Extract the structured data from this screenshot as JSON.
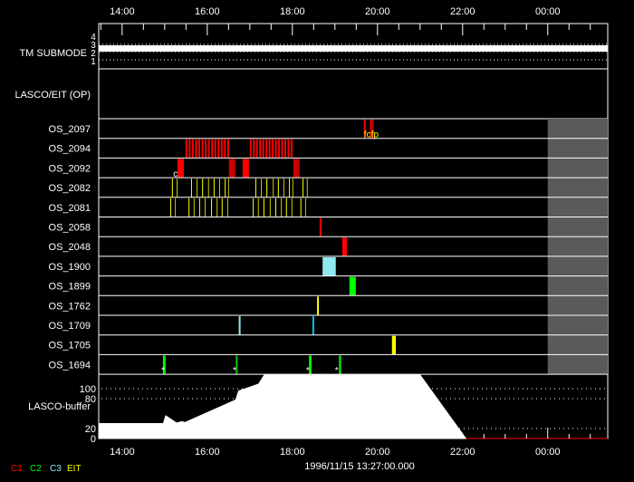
{
  "time_axis": {
    "start_hour": 13.45,
    "end_hour": 25.41,
    "tick_labels": [
      {
        "hour": 14,
        "label": "14:00"
      },
      {
        "hour": 16,
        "label": "16:00"
      },
      {
        "hour": 18,
        "label": "18:00"
      },
      {
        "hour": 20,
        "label": "20:00"
      },
      {
        "hour": 22,
        "label": "22:00"
      },
      {
        "hour": 24,
        "label": "00:00"
      }
    ]
  },
  "tm_submode": {
    "label": "TM SUBMODE",
    "levels": [
      "4",
      "3",
      "2",
      "1"
    ],
    "value": 3
  },
  "lasco_eit_label": "LASCO/EIT (OP)",
  "unavailable_from_hour": 24.0,
  "colors": {
    "c1": "#ff0000",
    "c1_dark": "#c80000",
    "c2": "#00ff00",
    "c2_dark": "#00c800",
    "c3": "#90e8f0",
    "c3_dark": "#00c8e0",
    "eit": "#ffff00",
    "eit_dark": "#c8c800",
    "gray": "#5a5a5a"
  },
  "rows": [
    {
      "name": "OS_2097",
      "events": [
        {
          "s": 19.68,
          "e": 19.72,
          "c": "c1"
        },
        {
          "s": 19.82,
          "e": 19.91,
          "c": "c1_dark"
        }
      ],
      "marks": [
        {
          "h": 19.68,
          "t": "fc"
        },
        {
          "h": 19.85,
          "t": "fp"
        }
      ]
    },
    {
      "name": "OS_2094",
      "groups": [
        {
          "s": 15.49,
          "e": 16.47,
          "n": 14,
          "c": "c1"
        },
        {
          "s": 17.0,
          "e": 17.96,
          "n": 14,
          "c": "c1"
        }
      ]
    },
    {
      "name": "OS_2092",
      "events": [
        {
          "s": 15.3,
          "e": 15.45,
          "c": "c1"
        },
        {
          "s": 16.51,
          "e": 16.66,
          "c": "c1_dark"
        },
        {
          "s": 16.83,
          "e": 16.98,
          "c": "c1"
        },
        {
          "s": 18.02,
          "e": 18.17,
          "c": "c1_dark"
        }
      ],
      "marks": [
        {
          "h": 15.2,
          "t": "c",
          "white": true
        }
      ]
    },
    {
      "name": "OS_2082",
      "lines": [
        15.17,
        15.28,
        15.62,
        15.75,
        15.88,
        16.02,
        16.15,
        16.28,
        16.41,
        16.49,
        17.13,
        17.26,
        17.39,
        17.54,
        17.66,
        17.79,
        17.92,
        18.0,
        18.24,
        18.34
      ],
      "c": "eit"
    },
    {
      "name": "OS_2081",
      "lines": [
        15.13,
        15.24,
        15.56,
        15.68,
        15.81,
        15.94,
        16.09,
        16.22,
        16.34,
        16.47,
        17.07,
        17.19,
        17.32,
        17.47,
        17.6,
        17.73,
        17.85,
        17.98,
        18.19,
        18.3
      ],
      "c": "eit"
    },
    {
      "name": "OS_2058",
      "events": [
        {
          "s": 18.64,
          "e": 18.68,
          "c": "c1"
        }
      ]
    },
    {
      "name": "OS_2048",
      "events": [
        {
          "s": 19.17,
          "e": 19.28,
          "c": "c1"
        }
      ]
    },
    {
      "name": "OS_1900",
      "events": [
        {
          "s": 18.71,
          "e": 19.02,
          "c": "c3"
        }
      ]
    },
    {
      "name": "OS_1899",
      "events": [
        {
          "s": 19.34,
          "e": 19.49,
          "c": "c2"
        }
      ]
    },
    {
      "name": "OS_1762",
      "events": [
        {
          "s": 18.58,
          "e": 18.62,
          "c": "eit"
        }
      ]
    },
    {
      "name": "OS_1709",
      "events": [
        {
          "s": 16.74,
          "e": 16.77,
          "c": "c3"
        },
        {
          "s": 18.47,
          "e": 18.51,
          "c": "c3_dark"
        }
      ]
    },
    {
      "name": "OS_1705",
      "events": [
        {
          "s": 20.34,
          "e": 20.43,
          "c": "eit"
        }
      ]
    },
    {
      "name": "OS_1694",
      "events": [
        {
          "s": 14.96,
          "e": 15.02,
          "c": "c2"
        },
        {
          "s": 16.67,
          "e": 16.7,
          "c": "c2_dark"
        },
        {
          "s": 18.39,
          "e": 18.45,
          "c": "c2"
        },
        {
          "s": 19.09,
          "e": 19.15,
          "c": "c2_dark"
        }
      ],
      "marks": [
        {
          "h": 14.92,
          "t": "*",
          "white": true
        },
        {
          "h": 16.6,
          "t": "*",
          "white": true
        },
        {
          "h": 18.32,
          "t": "*",
          "white": true
        },
        {
          "h": 19.0,
          "t": "*",
          "white": true
        }
      ]
    }
  ],
  "buffer": {
    "label": "LASCO-buffer",
    "y_ticks": [
      "100",
      "80",
      "20",
      "0"
    ],
    "y_tick_values": [
      100,
      80,
      20,
      0
    ],
    "y_max": 129,
    "profile_hours": [
      13.45,
      14.96,
      15.02,
      15.28,
      15.41,
      15.47,
      16.66,
      16.73,
      17.2,
      17.34,
      21.0,
      22.09
    ],
    "profile_values": [
      31,
      31,
      47,
      32,
      35,
      33,
      78,
      96,
      110,
      129,
      129,
      0
    ]
  },
  "legend": [
    {
      "label": "C1",
      "color": "#ff0000"
    },
    {
      "label": "C2",
      "color": "#00ff00"
    },
    {
      "label": "C3",
      "color": "#90e8f0"
    },
    {
      "label": "EIT",
      "color": "#ffff00"
    }
  ],
  "timestamp": "1996/11/15 13:27:00.000"
}
